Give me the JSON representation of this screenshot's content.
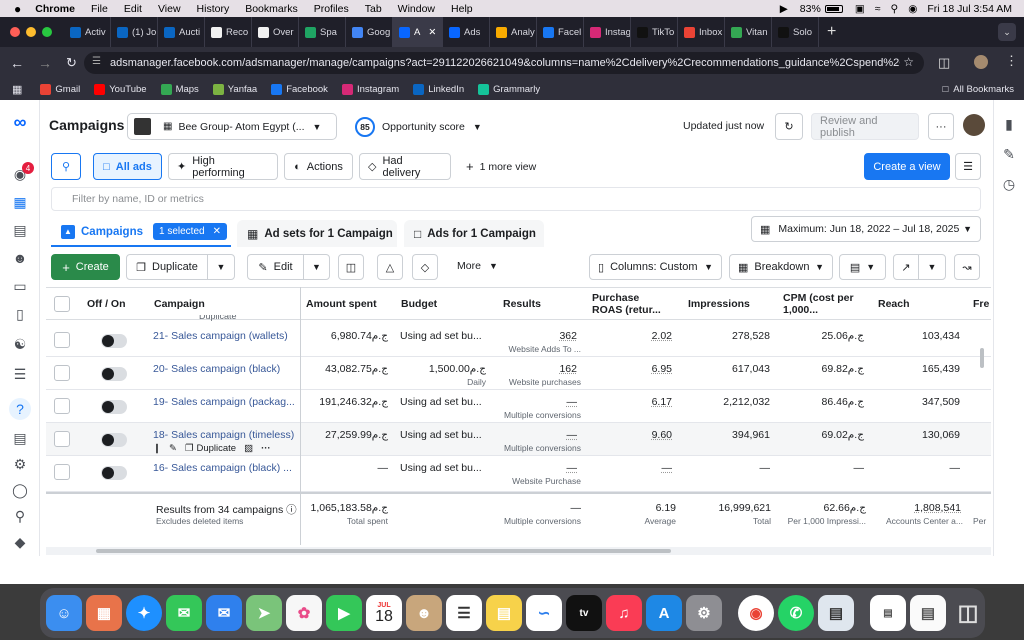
{
  "menubar": {
    "apple": "",
    "items": [
      "Chrome",
      "File",
      "Edit",
      "View",
      "History",
      "Bookmarks",
      "Profiles",
      "Tab",
      "Window",
      "Help"
    ],
    "battery": "83%",
    "datetime": "Fri 18 Jul  3:54 AM"
  },
  "tabs": [
    {
      "label": "Activ",
      "icon": "linkedin-icon",
      "color": "#0a66c2"
    },
    {
      "label": "(1) Jo",
      "icon": "linkedin-icon",
      "color": "#0a66c2"
    },
    {
      "label": "Aucti",
      "icon": "linkedin-icon",
      "color": "#0a66c2"
    },
    {
      "label": "Reco",
      "icon": "arrow-icon",
      "color": "#f2f2f2"
    },
    {
      "label": "Over",
      "icon": "arrow-icon",
      "color": "#f2f2f2"
    },
    {
      "label": "Spa",
      "icon": "sheets-icon",
      "color": "#1fa463"
    },
    {
      "label": "Goog",
      "icon": "docs-icon",
      "color": "#4285f4"
    },
    {
      "label": "A",
      "icon": "meta-icon",
      "color": "#0866ff",
      "active": true
    },
    {
      "label": "Ads",
      "icon": "meta-icon",
      "color": "#0866ff"
    },
    {
      "label": "Analy",
      "icon": "analytics-icon",
      "color": "#f9ab00"
    },
    {
      "label": "Facel",
      "icon": "facebook-icon",
      "color": "#1877f2"
    },
    {
      "label": "Instag",
      "icon": "instagram-icon",
      "color": "#d62976"
    },
    {
      "label": "TikTo",
      "icon": "tiktok-icon",
      "color": "#111111"
    },
    {
      "label": "Inbox",
      "icon": "gmail-icon",
      "color": "#ea4335"
    },
    {
      "label": "Vitan",
      "icon": "chrome-icon",
      "color": "#34a853"
    },
    {
      "label": "Solo",
      "icon": "tiktok-icon",
      "color": "#111111"
    }
  ],
  "url": "adsmanager.facebook.com/adsmanager/manage/campaigns?act=291122026621049&columns=name%2Cdelivery%2Crecommendations_guidance%2Cspend%2Cb...",
  "bookmarks": [
    {
      "label": "Gmail",
      "icon": "gmail-icon",
      "color": "#ea4335"
    },
    {
      "label": "YouTube",
      "icon": "youtube-icon",
      "color": "#ff0000"
    },
    {
      "label": "Maps",
      "icon": "maps-icon",
      "color": "#34a853"
    },
    {
      "label": "Yanfaa",
      "icon": "yanfaa-icon",
      "color": "#7cb342"
    },
    {
      "label": "Facebook",
      "icon": "facebook-icon",
      "color": "#1877f2"
    },
    {
      "label": "Instagram",
      "icon": "instagram-icon",
      "color": "#d62976"
    },
    {
      "label": "LinkedIn",
      "icon": "linkedin-icon",
      "color": "#0a66c2"
    },
    {
      "label": "Grammarly",
      "icon": "grammarly-icon",
      "color": "#15c39a"
    }
  ],
  "all_bookmarks": "All Bookmarks",
  "header": {
    "title": "Campaigns",
    "account": "Bee Group- Atom Egypt (...",
    "score": "85",
    "opportunity": "Opportunity score",
    "updated": "Updated just now",
    "review": "Review and publish",
    "more": "···"
  },
  "filters": {
    "all_ads": "All ads",
    "high_performing": "High performing",
    "actions": "Actions",
    "had_delivery": "Had delivery",
    "more_view": "1 more view",
    "create_view": "Create a view",
    "search_placeholder": "Filter by name, ID or metrics"
  },
  "level_tabs": {
    "campaigns": "Campaigns",
    "selected": "1 selected",
    "adsets": "Ad sets for 1 Campaign",
    "ads": "Ads for 1 Campaign"
  },
  "date_range": "Maximum: Jun 18, 2022 – Jul 18, 2025",
  "toolbar": {
    "create": "Create",
    "duplicate": "Duplicate",
    "edit": "Edit",
    "more": "More",
    "columns": "Columns: Custom",
    "breakdown": "Breakdown"
  },
  "columns": [
    "Off / On",
    "Campaign",
    "Amount spent",
    "Budget",
    "Results",
    "Purchase ROAS (retur...",
    "Impressions",
    "CPM (cost per 1,000...",
    "Reach",
    "Fre"
  ],
  "rows": [
    {
      "name": "21- Sales campaign (wallets)",
      "spent": "6,980.74ج.م",
      "budget": "Using ad set bu...",
      "budget_sub": "",
      "results": "362",
      "results_sub": "Website Adds To ...",
      "roas": "2.02",
      "impressions": "278,528",
      "cpm": "25.06ج.م",
      "reach": "103,434"
    },
    {
      "name": "20- Sales campaign (black)",
      "spent": "43,082.75ج.م",
      "budget": "1,500.00ج.م",
      "budget_sub": "Daily",
      "results": "162",
      "results_sub": "Website purchases",
      "roas": "6.95",
      "impressions": "617,043",
      "cpm": "69.82ج.م",
      "reach": "165,439"
    },
    {
      "name": "19- Sales campaign (packag...",
      "spent": "191,246.32ج.م",
      "budget": "Using ad set bu...",
      "budget_sub": "",
      "results": "—",
      "results_sub": "Multiple conversions",
      "roas": "6.17",
      "impressions": "2,212,032",
      "cpm": "86.46ج.م",
      "reach": "347,509"
    },
    {
      "name": "18- Sales campaign (timeless)",
      "spent": "27,259.99ج.م",
      "budget": "Using ad set bu...",
      "budget_sub": "",
      "results": "—",
      "results_sub": "Multiple conversions",
      "roas": "9.60",
      "impressions": "394,961",
      "cpm": "69.02ج.م",
      "reach": "130,069",
      "hover": true
    },
    {
      "name": "16- Sales campaign (black) ...",
      "spent": "—",
      "budget": "Using ad set bu...",
      "budget_sub": "",
      "results": "—",
      "results_sub": "Website Purchase",
      "roas": "—",
      "impressions": "—",
      "cpm": "—",
      "reach": "—"
    }
  ],
  "row_actions": {
    "duplicate": "Duplicate",
    "more": "···",
    "top_partial": "Duplicate"
  },
  "totals": {
    "label": "Results from 34 campaigns",
    "sub": "Excludes deleted items",
    "spent": "1,065,183.58ج.م",
    "spent_sub": "Total spent",
    "results": "—",
    "results_sub": "Multiple conversions",
    "roas": "6.19",
    "roas_sub": "Average",
    "impressions": "16,999,621",
    "impressions_sub": "Total",
    "cpm": "62.66ج.م",
    "cpm_sub": "Per 1,000 Impressi...",
    "reach": "1,808,541",
    "reach_sub": "Accounts Center a...",
    "fre_sub": "Per"
  },
  "notification_count": "4",
  "dock": {
    "calendar_month": "JUL",
    "calendar_day": "18"
  },
  "colors": {
    "accent": "#1877f2",
    "create": "#2a8a4a",
    "link": "#385898"
  }
}
